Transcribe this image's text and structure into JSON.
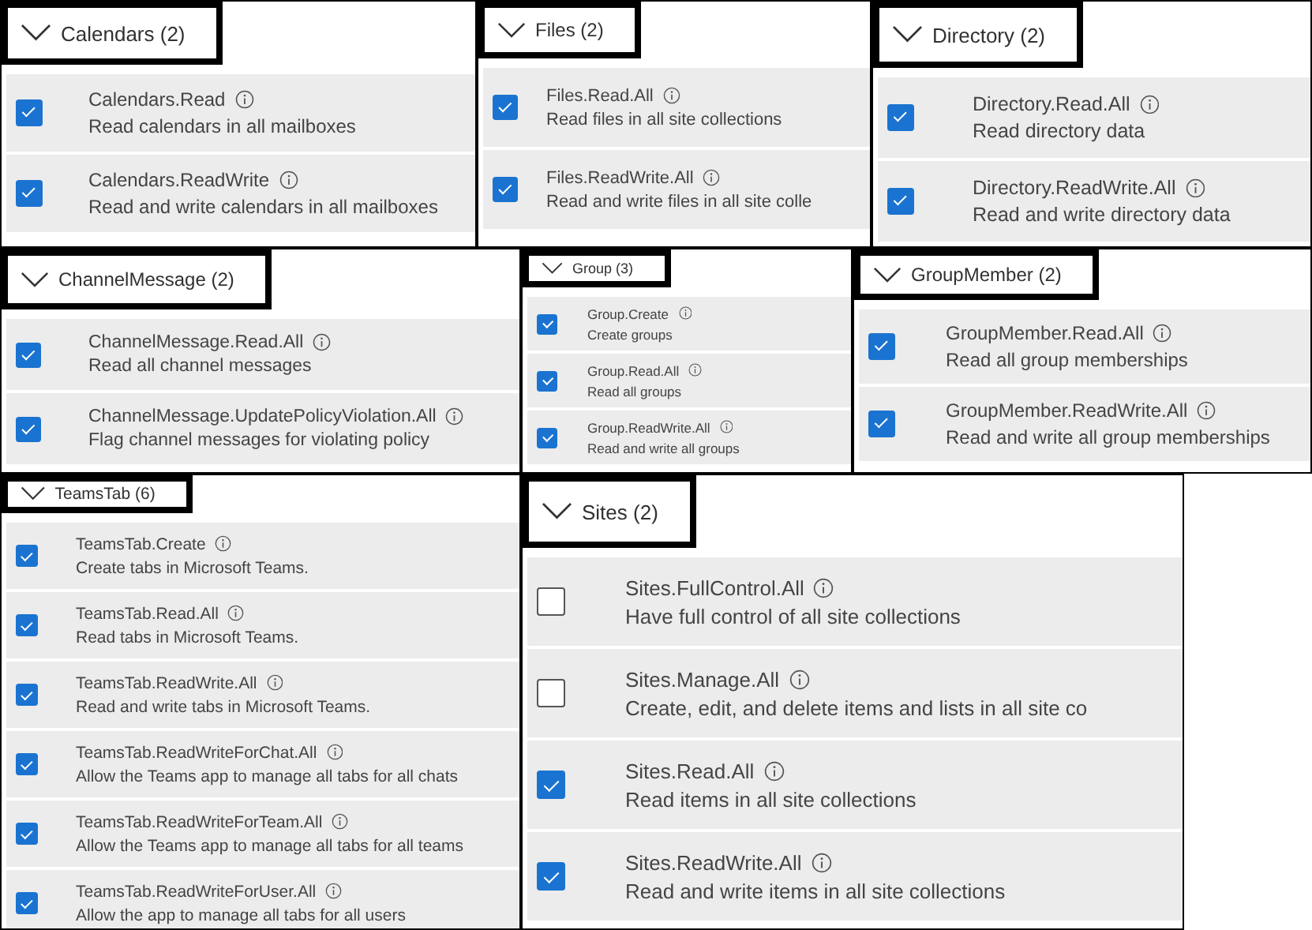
{
  "panel_rows": [
    {
      "panels": [
        {
          "title": "Calendars (2)",
          "expanded": true,
          "permissions": [
            {
              "name": "Calendars.Read",
              "description": "Read calendars in all mailboxes",
              "checked": true
            },
            {
              "name": "Calendars.ReadWrite",
              "description": "Read and write calendars in all mailboxes",
              "checked": true
            }
          ]
        },
        {
          "title": "Files (2)",
          "expanded": true,
          "permissions": [
            {
              "name": "Files.Read.All",
              "description": "Read files in all site collections",
              "checked": true
            },
            {
              "name": "Files.ReadWrite.All",
              "description": "Read and write files in all site colle",
              "checked": true
            }
          ]
        },
        {
          "title": "Directory (2)",
          "expanded": true,
          "permissions": [
            {
              "name": "Directory.Read.All",
              "description": "Read directory data",
              "checked": true
            },
            {
              "name": "Directory.ReadWrite.All",
              "description": "Read and write directory data",
              "checked": true
            }
          ]
        }
      ]
    },
    {
      "panels": [
        {
          "title": "ChannelMessage (2)",
          "expanded": true,
          "permissions": [
            {
              "name": "ChannelMessage.Read.All",
              "description": "Read all channel messages",
              "checked": true
            },
            {
              "name": "ChannelMessage.UpdatePolicyViolation.All",
              "description": "Flag channel messages for violating policy",
              "checked": true
            }
          ]
        },
        {
          "title": "Group (3)",
          "expanded": true,
          "permissions": [
            {
              "name": "Group.Create",
              "description": "Create groups",
              "checked": true
            },
            {
              "name": "Group.Read.All",
              "description": "Read all groups",
              "checked": true
            },
            {
              "name": "Group.ReadWrite.All",
              "description": "Read and write all groups",
              "checked": true
            }
          ]
        },
        {
          "title": "GroupMember (2)",
          "expanded": true,
          "permissions": [
            {
              "name": "GroupMember.Read.All",
              "description": "Read all group memberships",
              "checked": true
            },
            {
              "name": "GroupMember.ReadWrite.All",
              "description": "Read and write all group memberships",
              "checked": true
            }
          ]
        }
      ]
    },
    {
      "panels": [
        {
          "title": "TeamsTab (6)",
          "expanded": true,
          "permissions": [
            {
              "name": "TeamsTab.Create",
              "description": "Create tabs in Microsoft Teams.",
              "checked": true
            },
            {
              "name": "TeamsTab.Read.All",
              "description": "Read tabs in Microsoft Teams.",
              "checked": true
            },
            {
              "name": "TeamsTab.ReadWrite.All",
              "description": "Read and write tabs in Microsoft Teams.",
              "checked": true
            },
            {
              "name": "TeamsTab.ReadWriteForChat.All",
              "description": "Allow the Teams app to manage all tabs for all chats",
              "checked": true
            },
            {
              "name": "TeamsTab.ReadWriteForTeam.All",
              "description": "Allow the Teams app to manage all tabs for all teams",
              "checked": true
            },
            {
              "name": "TeamsTab.ReadWriteForUser.All",
              "description": "Allow the app to manage all tabs for all users",
              "checked": true
            }
          ]
        },
        {
          "title": "Sites (2)",
          "expanded": true,
          "permissions": [
            {
              "name": "Sites.FullControl.All",
              "description": "Have full control of all site collections",
              "checked": false
            },
            {
              "name": "Sites.Manage.All",
              "description": "Create, edit, and delete items and lists in all site co",
              "checked": false
            },
            {
              "name": "Sites.Read.All",
              "description": "Read items in all site collections",
              "checked": true
            },
            {
              "name": "Sites.ReadWrite.All",
              "description": "Read and write items in all site collections",
              "checked": true
            }
          ]
        }
      ]
    }
  ]
}
